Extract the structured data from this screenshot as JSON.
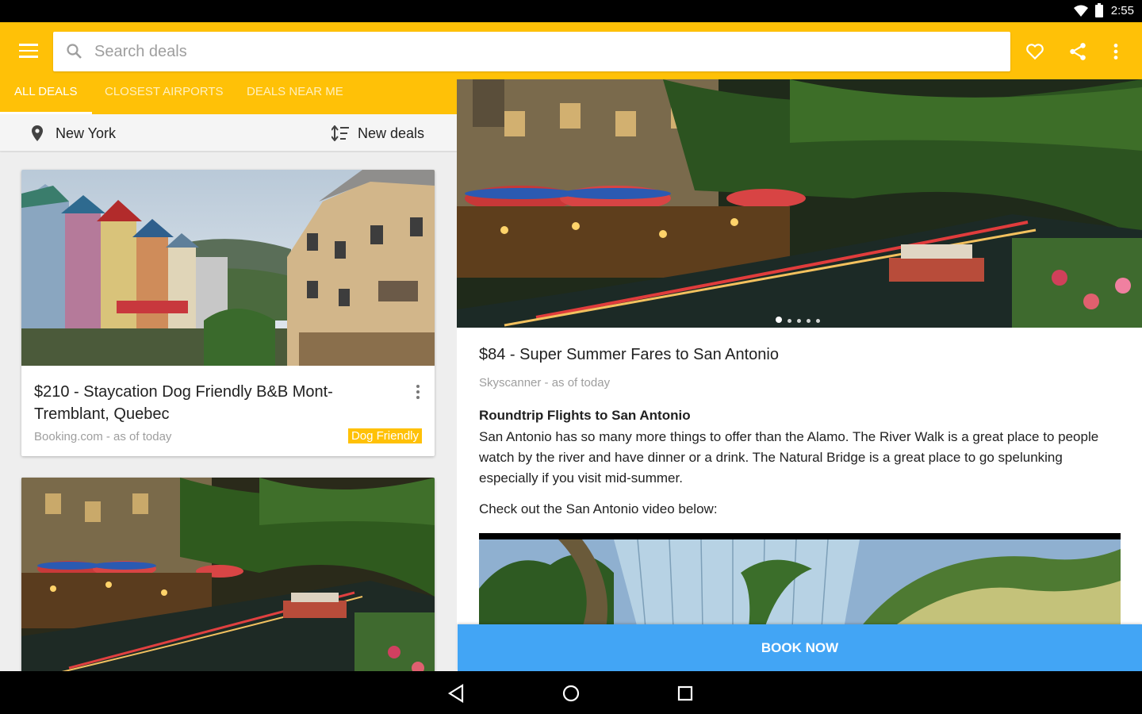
{
  "status_bar": {
    "time": "2:55"
  },
  "toolbar": {
    "search_placeholder": "Search deals",
    "accent_color": "#ffc107"
  },
  "tabs": [
    {
      "label": "ALL DEALS",
      "active": true
    },
    {
      "label": "CLOSEST AIRPORTS",
      "active": false
    },
    {
      "label": "DEALS NEAR ME",
      "active": false
    }
  ],
  "filters": {
    "location": "New York",
    "sort": "New deals"
  },
  "deals": [
    {
      "title": "$210 - Staycation Dog Friendly B&B Mont-Tremblant, Quebec",
      "source": "Booking.com - as of today",
      "badge": "Dog Friendly"
    }
  ],
  "detail": {
    "title": "$84 - Super Summer Fares to San Antonio",
    "source": "Skyscanner - as of today",
    "heading": "Roundtrip Flights to San Antonio",
    "body": "San Antonio has so many more things to offer than the Alamo. The River Walk is a great place to people watch by the river and have dinner or a drink. The Natural Bridge is a great place to go spelunking especially if you visit mid-summer.",
    "cta": "Check out the San Antonio video below:",
    "gallery_count": 5,
    "gallery_active": 1
  },
  "book_button": {
    "label": "BOOK NOW",
    "color": "#42a5f5"
  }
}
